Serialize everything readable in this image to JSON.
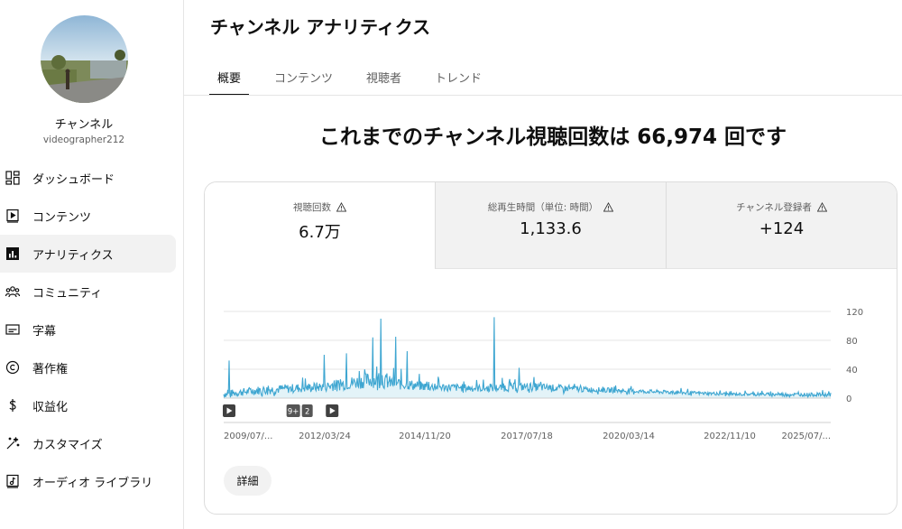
{
  "sidebar": {
    "channel_name": "チャンネル",
    "channel_handle": "videographer212",
    "items": [
      {
        "label": "ダッシュボード",
        "icon": "dashboard-icon"
      },
      {
        "label": "コンテンツ",
        "icon": "content-icon"
      },
      {
        "label": "アナリティクス",
        "icon": "analytics-icon",
        "active": true
      },
      {
        "label": "コミュニティ",
        "icon": "community-icon"
      },
      {
        "label": "字幕",
        "icon": "subtitles-icon"
      },
      {
        "label": "著作権",
        "icon": "copyright-icon"
      },
      {
        "label": "収益化",
        "icon": "dollar-icon"
      },
      {
        "label": "カスタマイズ",
        "icon": "magic-wand-icon"
      },
      {
        "label": "オーディオ ライブラリ",
        "icon": "audio-library-icon"
      }
    ]
  },
  "header": {
    "title": "チャンネル アナリティクス",
    "tabs": [
      "概要",
      "コンテンツ",
      "視聴者",
      "トレンド"
    ],
    "active_tab": 0
  },
  "headline": {
    "prefix": "これまでのチャンネル視聴回数は ",
    "value": "66,974",
    "suffix": " 回です"
  },
  "metrics": [
    {
      "label": "視聴回数",
      "value": "6.7万"
    },
    {
      "label": "総再生時間（単位: 時間）",
      "value": "1,133.6"
    },
    {
      "label": "チャンネル登録者",
      "value": "+124"
    }
  ],
  "chart_data": {
    "type": "area",
    "series_color": "#3ea6d1",
    "fill_color": "#e3f3f8",
    "y_ticks": [
      0,
      40,
      80,
      120
    ],
    "ylim": [
      0,
      120
    ],
    "x_tick_labels": [
      "2009/07/...",
      "2012/03/24",
      "2014/11/20",
      "2017/07/18",
      "2020/03/14",
      "2022/11/10",
      "2025/07/..."
    ],
    "x_range": [
      "2009-07-01",
      "2025-07-31"
    ],
    "grid": true,
    "markers": [
      {
        "type": "play",
        "date": "2009-07-01"
      },
      {
        "type": "badge",
        "labels": [
          "9+",
          "2"
        ],
        "date": "2011-03-01"
      },
      {
        "type": "play",
        "date": "2012-03-24"
      }
    ],
    "envelope": [
      {
        "date": "2009-07-01",
        "base": 4,
        "spread": 10
      },
      {
        "date": "2010-06-01",
        "base": 9,
        "spread": 12
      },
      {
        "date": "2012-03-24",
        "base": 14,
        "spread": 14
      },
      {
        "date": "2013-06-01",
        "base": 22,
        "spread": 22
      },
      {
        "date": "2014-01-01",
        "base": 18,
        "spread": 18
      },
      {
        "date": "2014-11-20",
        "base": 14,
        "spread": 12
      },
      {
        "date": "2016-06-01",
        "base": 12,
        "spread": 10
      },
      {
        "date": "2017-07-18",
        "base": 14,
        "spread": 12
      },
      {
        "date": "2019-01-01",
        "base": 11,
        "spread": 8
      },
      {
        "date": "2020-03-14",
        "base": 9,
        "spread": 6
      },
      {
        "date": "2022-11-10",
        "base": 5,
        "spread": 4
      },
      {
        "date": "2025-07-31",
        "base": 4,
        "spread": 5
      }
    ],
    "spikes": [
      {
        "date": "2009-08-20",
        "value": 52
      },
      {
        "date": "2012-03-01",
        "value": 60
      },
      {
        "date": "2012-10-01",
        "value": 62
      },
      {
        "date": "2013-06-15",
        "value": 84
      },
      {
        "date": "2013-09-01",
        "value": 110
      },
      {
        "date": "2014-01-20",
        "value": 85
      },
      {
        "date": "2014-05-10",
        "value": 65
      },
      {
        "date": "2016-09-01",
        "value": 112
      },
      {
        "date": "2017-05-01",
        "value": 42
      }
    ]
  },
  "detail_button": "詳細"
}
